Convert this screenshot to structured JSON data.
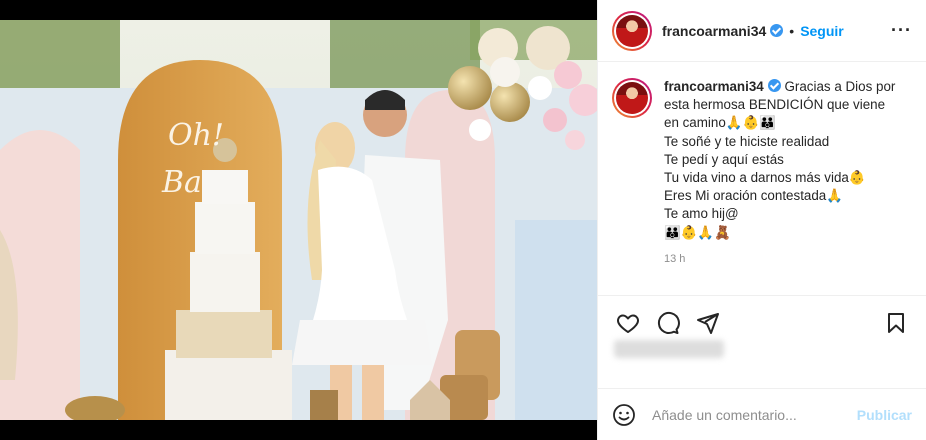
{
  "post": {
    "username": "francoarmani34",
    "separator": "•",
    "follow_label": "Seguir",
    "more_label": "···",
    "caption_lines": [
      "Gracias a Dios por",
      "esta hermosa BENDICIÓN que viene",
      "en camino🙏👶👪",
      "Te soñé y te hiciste realidad",
      "Te pedí y aquí estás",
      "Tu vida vino a darnos más vida👶",
      "Eres Mi oración contestada🙏",
      "Te amo hij@",
      "👪👶🙏🧸"
    ],
    "time_ago": "13 h"
  },
  "comment": {
    "placeholder": "Añade un comentario...",
    "publish_label": "Publicar"
  },
  "icons": {
    "like": "heart-icon",
    "comment": "comment-icon",
    "share": "share-icon",
    "save": "bookmark-icon",
    "emoji": "smiley-icon"
  },
  "colors": {
    "follow": "#0095f6",
    "publish_disabled": "#b2dffc",
    "verified": "#3897f0"
  }
}
